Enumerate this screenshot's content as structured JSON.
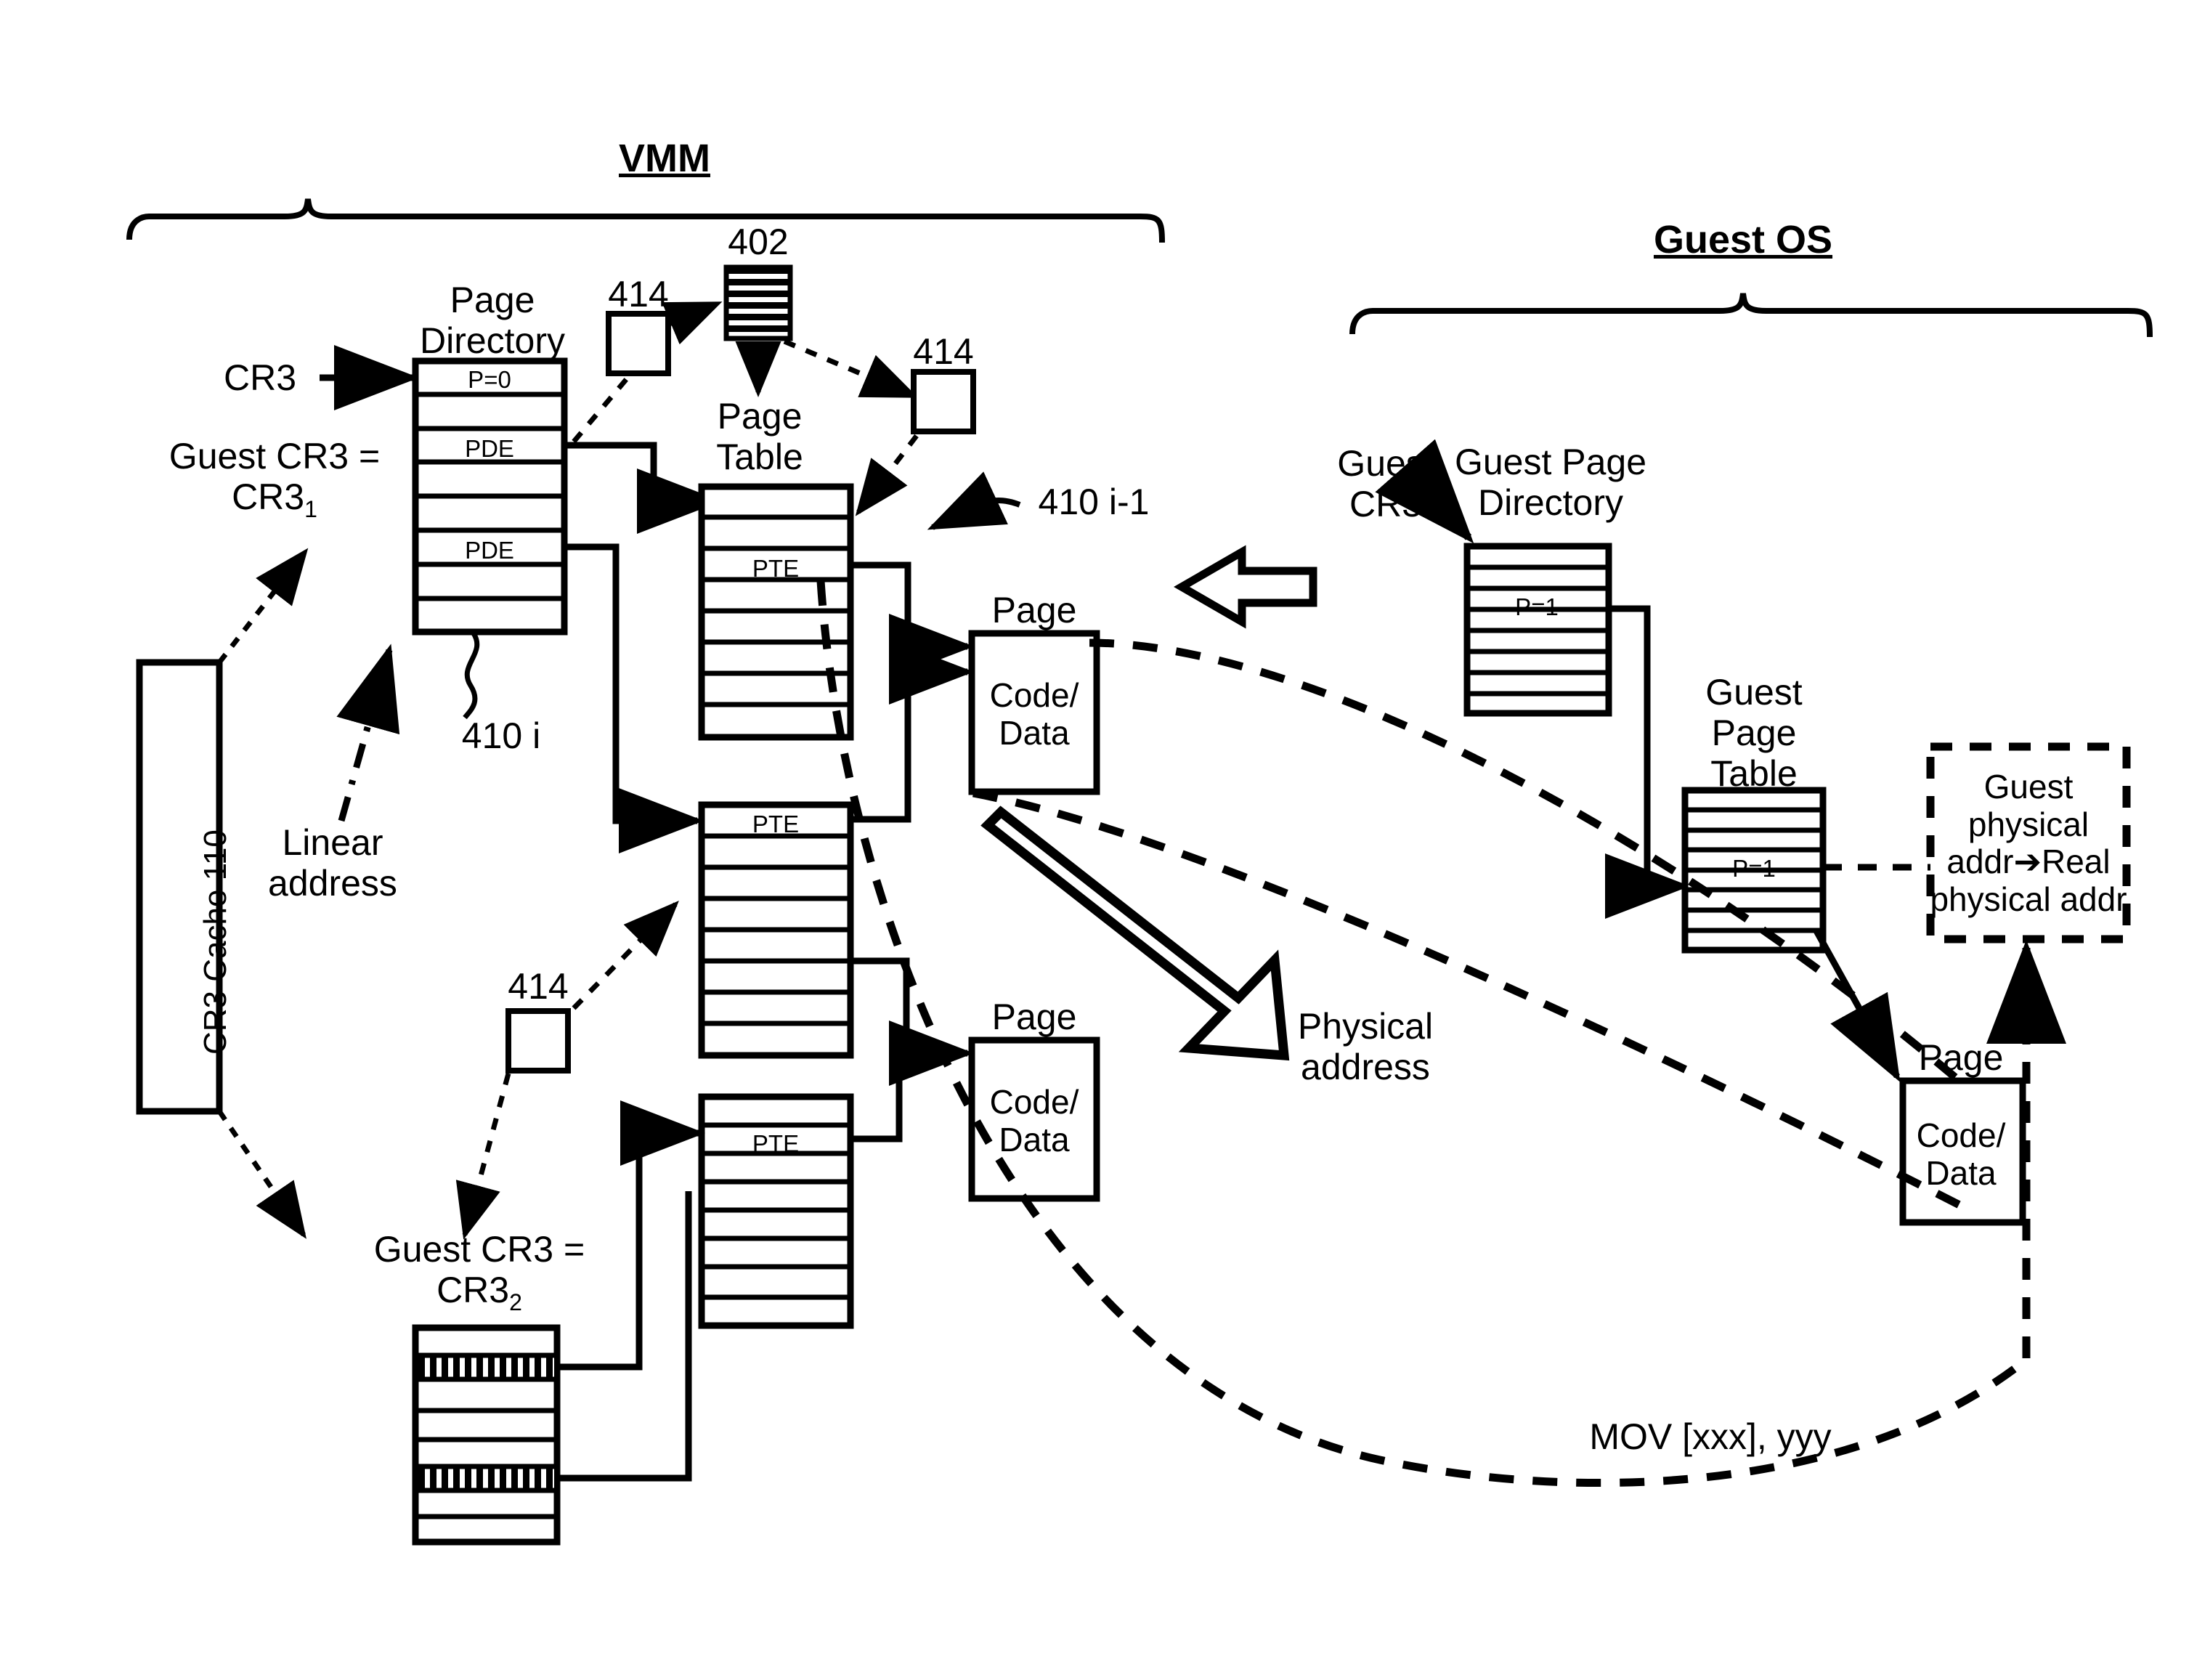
{
  "diagram": {
    "title_vmm": "VMM",
    "title_guest": "Guest OS"
  },
  "vmm": {
    "cr3_label": "CR3",
    "guest_cr3_1_line1": "Guest CR3 =",
    "guest_cr3_1_line2": "CR3",
    "guest_cr3_1_sub": "1",
    "guest_cr3_2_line1": "Guest CR3 =",
    "guest_cr3_2_line2": "CR3",
    "guest_cr3_2_sub": "2",
    "cr3_cache_label": "CR3 Cache 110",
    "page_directory_line1": "Page",
    "page_directory_line2": "Directory",
    "page_table_line1": "Page",
    "page_table_line2": "Table",
    "linear_address_line1": "Linear",
    "linear_address_line2": "address",
    "pde_label": "PDE",
    "pte_label": "PTE",
    "p0_label": "P=0",
    "ref_402": "402",
    "ref_414_a": "414",
    "ref_414_b": "414",
    "ref_414_c": "414",
    "ref_410_i": "410 i",
    "ref_410_i_minus_1": "410 i-1",
    "page_label": "Page",
    "code_data_line1": "Code/",
    "code_data_line2": "Data",
    "physical_address_line1": "Physical",
    "physical_address_line2": "address"
  },
  "guest": {
    "guest_cr3_line1": "Guest",
    "guest_cr3_line2": "CR3",
    "guest_page_directory_line1": "Guest Page",
    "guest_page_directory_line2": "Directory",
    "guest_page_table_line1": "Guest",
    "guest_page_table_line2": "Page",
    "guest_page_table_line3": "Table",
    "p1_label": "P=1",
    "page_label": "Page",
    "code_data_line1": "Code/",
    "code_data_line2": "Data",
    "translation_line1": "Guest",
    "translation_line2": "physical",
    "translation_line3": "addr➔Real",
    "translation_line4": "physical addr",
    "mov_instruction": "MOV [xxx], yyy"
  },
  "colors": {
    "stroke": "#000000",
    "background": "#ffffff"
  }
}
